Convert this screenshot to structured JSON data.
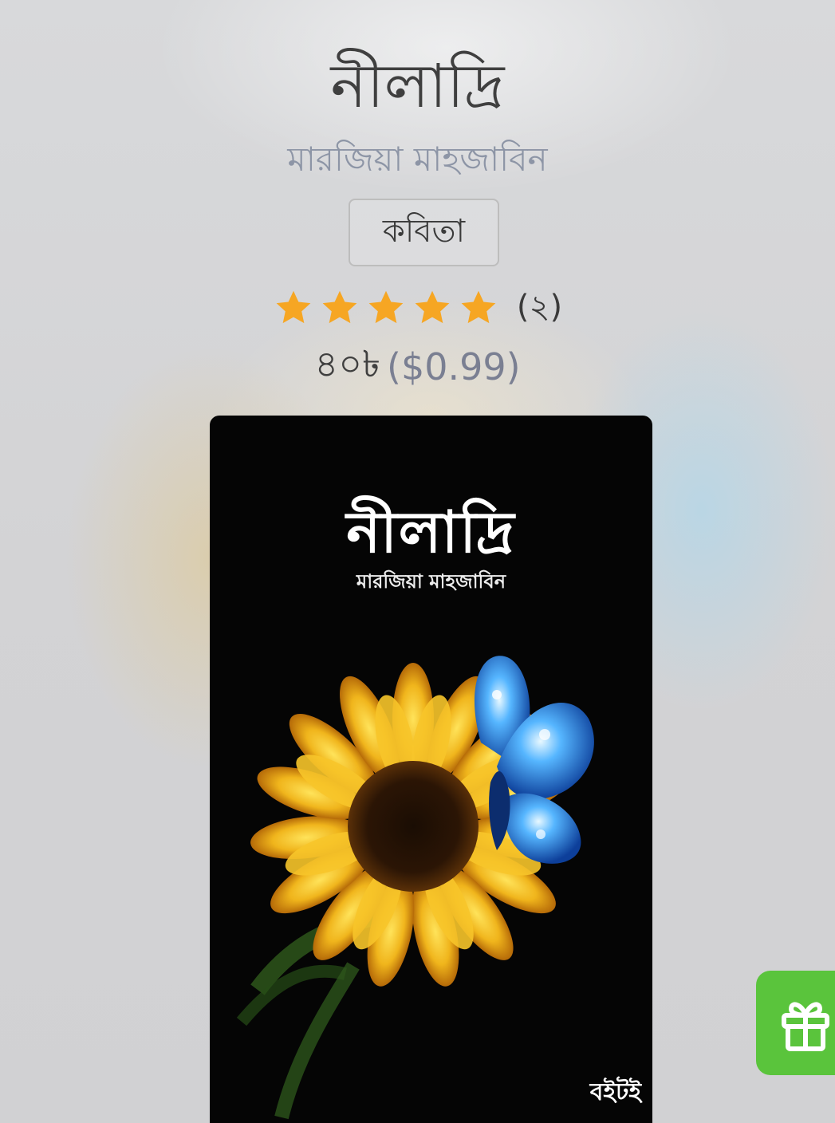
{
  "book": {
    "title": "নীলাদ্রি",
    "author": "মারজিয়া মাহজাবিন",
    "genre": "কবিতা",
    "rating": {
      "stars": 5,
      "count_label": "(২)"
    },
    "price": {
      "bdt": "৪০৳",
      "usd": "($0.99)"
    }
  },
  "cover": {
    "title": "নীলাদ্রি",
    "author": "মারজিয়া মাহজাবিন",
    "publisher": "বইটই"
  },
  "colors": {
    "star": "#f6a623",
    "gift_button": "#5ac43c"
  },
  "icons": {
    "gift": "gift-icon",
    "star": "star-icon"
  }
}
